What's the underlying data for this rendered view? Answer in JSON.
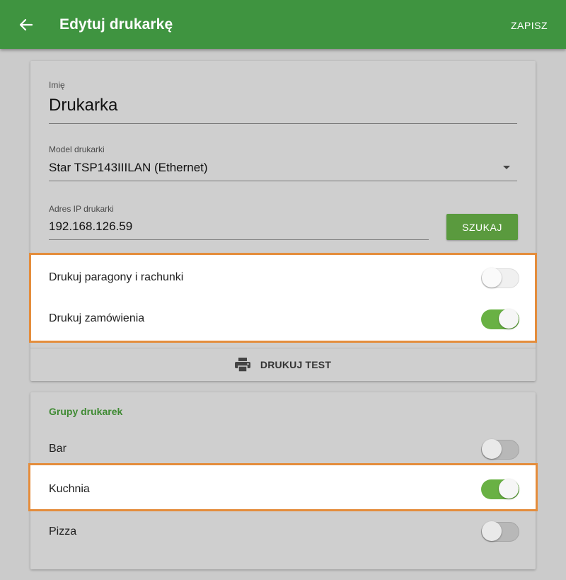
{
  "appbar": {
    "back_icon": "arrow-left-icon",
    "title": "Edytuj drukarkę",
    "save_label": "ZAPISZ",
    "color": "#3f9440"
  },
  "printer": {
    "name_label": "Imię",
    "name_value": "Drukarka",
    "model_label": "Model drukarki",
    "model_value": "Star TSP143IIILAN (Ethernet)",
    "ip_label": "Adres IP drukarki",
    "ip_value": "192.168.126.59",
    "search_label": "SZUKAJ",
    "print_receipts_label": "Drukuj paragony i rachunki",
    "print_receipts_on": false,
    "print_orders_label": "Drukuj zamówienia",
    "print_orders_on": true,
    "print_test_label": "DRUKUJ TEST",
    "print_test_icon": "printer-icon"
  },
  "groups": {
    "title": "Grupy drukarek",
    "items": [
      {
        "label": "Bar",
        "on": false
      },
      {
        "label": "Kuchnia",
        "on": true
      },
      {
        "label": "Pizza",
        "on": false
      }
    ]
  },
  "colors": {
    "accent": "#3f9440",
    "toggle_on": "#69b144",
    "highlight_border": "#e48d3c"
  }
}
